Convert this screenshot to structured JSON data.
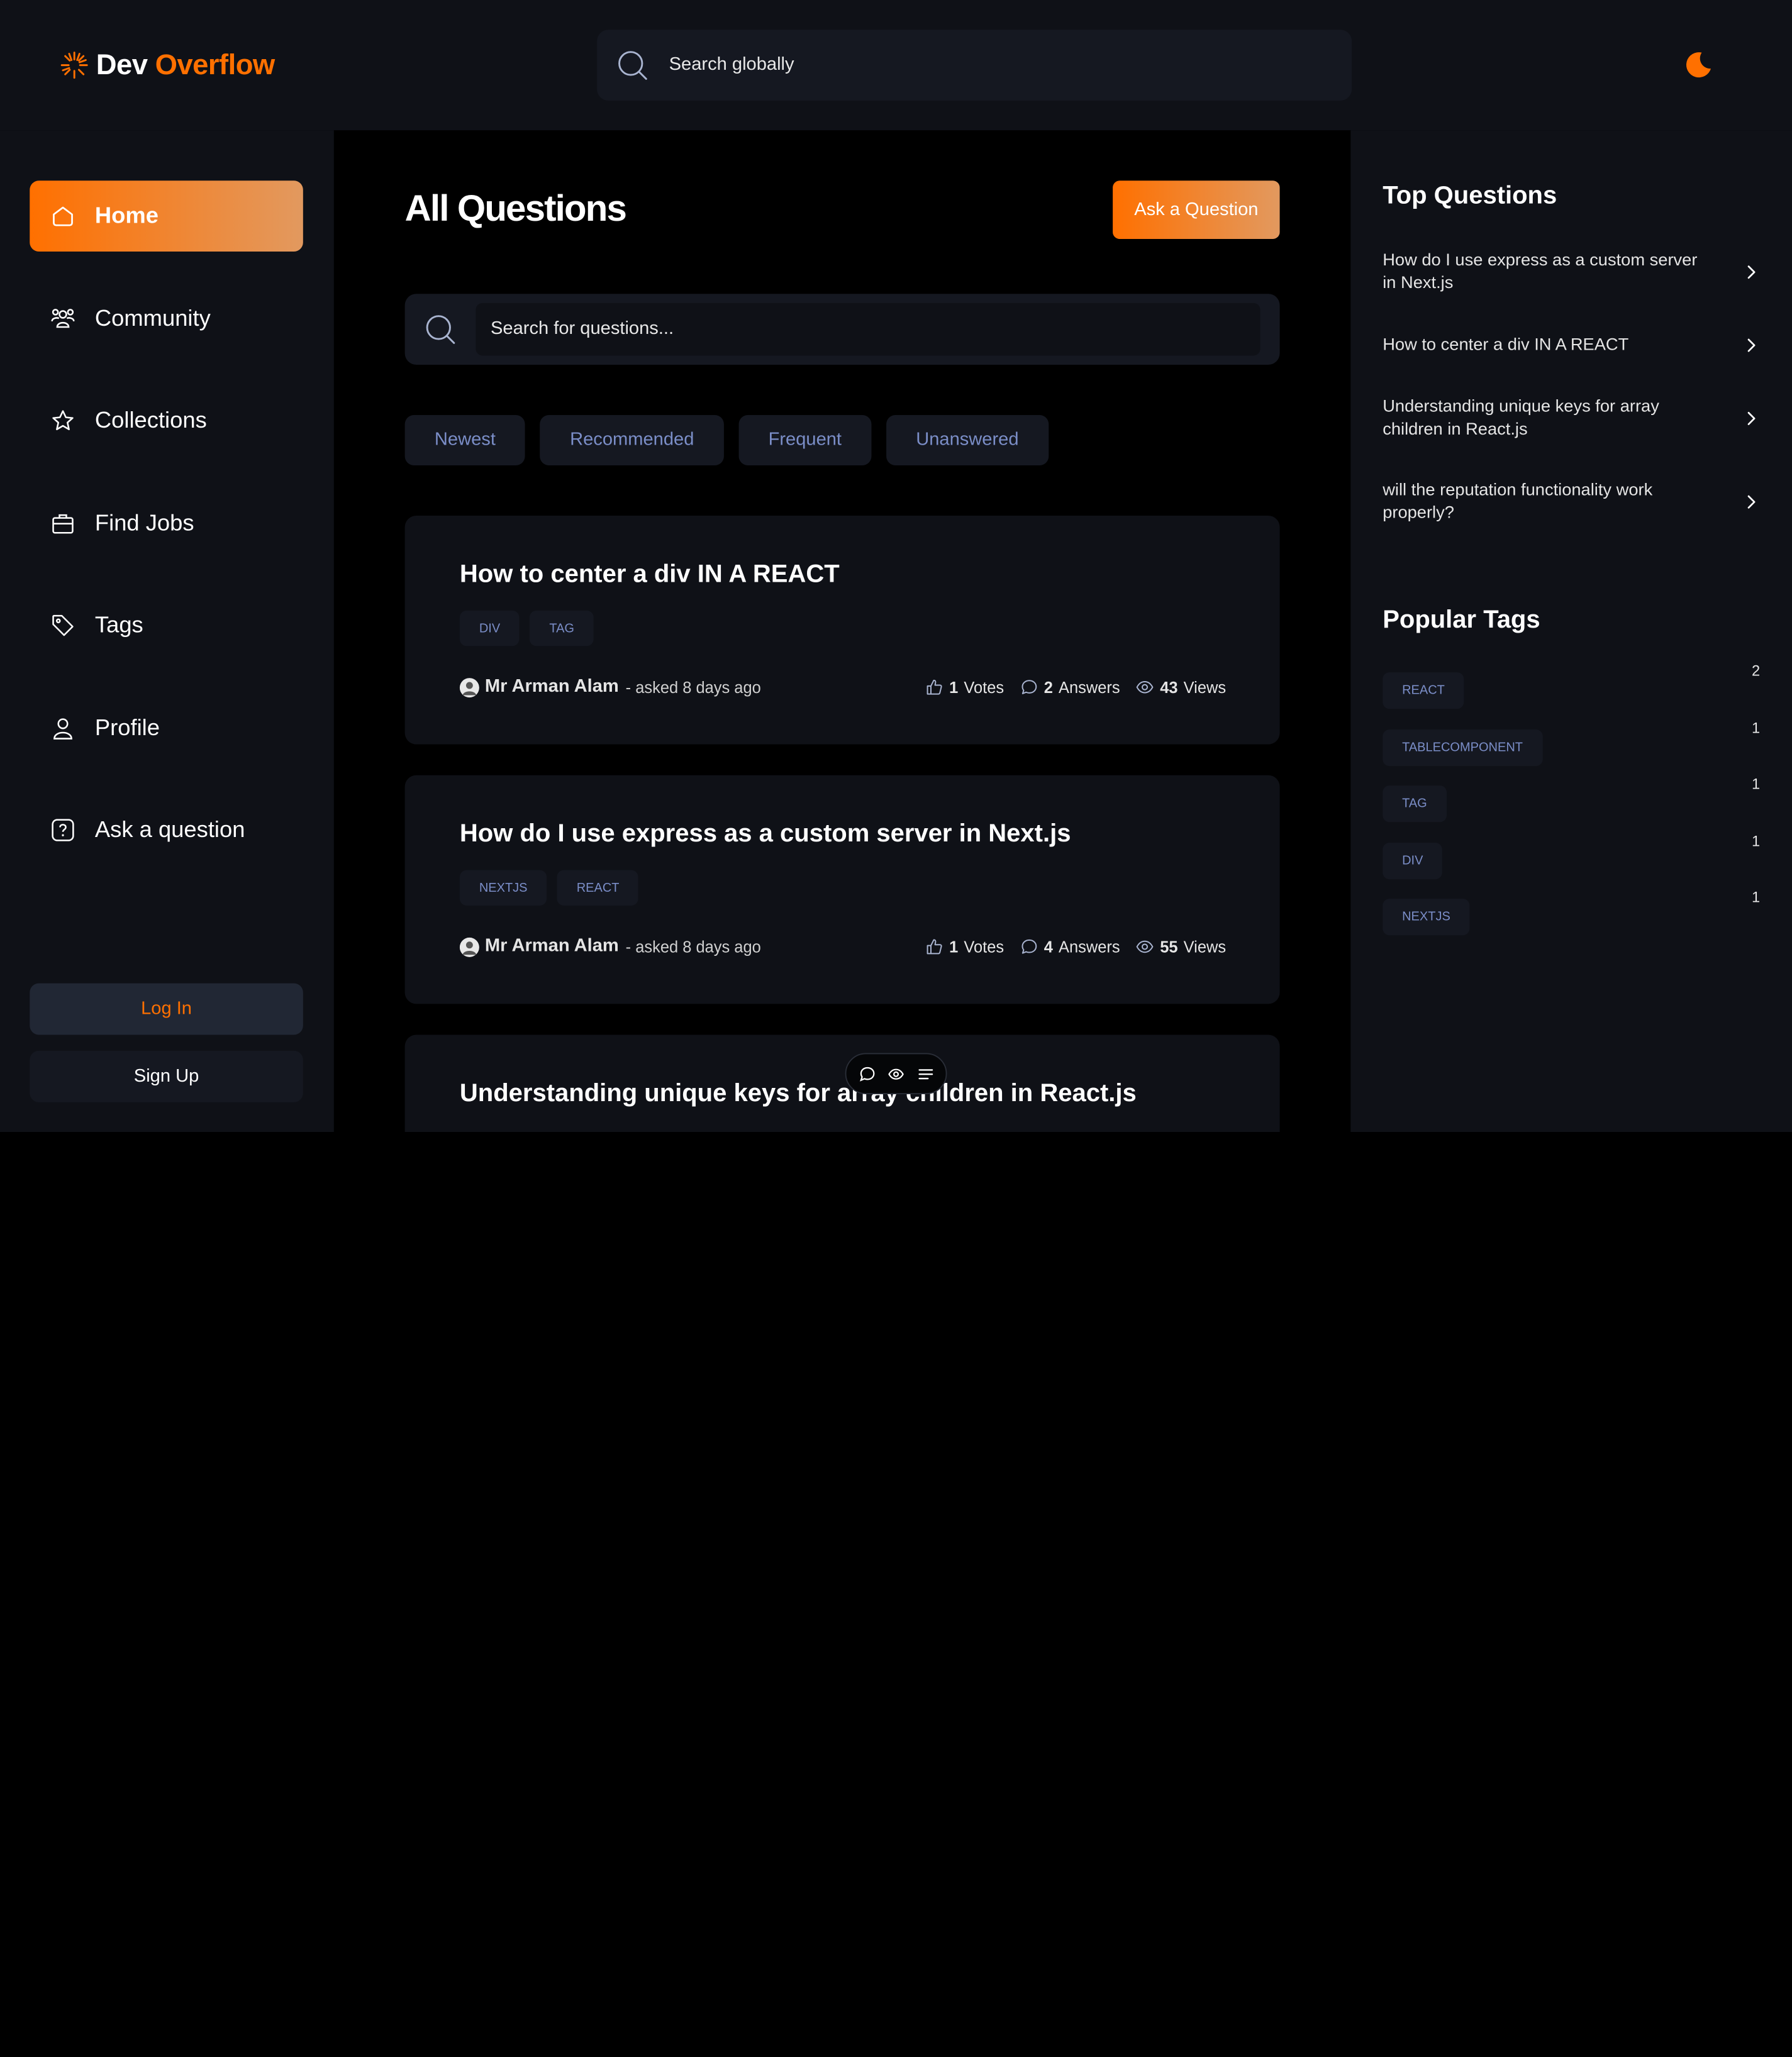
{
  "brand": {
    "part1": "Dev",
    "part2": "Overflow"
  },
  "global_search": {
    "placeholder": "Search globally"
  },
  "nav": [
    {
      "label": "Home",
      "icon": "home-icon",
      "active": true
    },
    {
      "label": "Community",
      "icon": "users-icon"
    },
    {
      "label": "Collections",
      "icon": "star-icon"
    },
    {
      "label": "Find Jobs",
      "icon": "briefcase-icon"
    },
    {
      "label": "Tags",
      "icon": "tag-icon"
    },
    {
      "label": "Profile",
      "icon": "user-icon"
    },
    {
      "label": "Ask a question",
      "icon": "question-icon"
    }
  ],
  "auth": {
    "login": "Log In",
    "signup": "Sign Up"
  },
  "main": {
    "title": "All Questions",
    "ask_button": "Ask a Question",
    "search_placeholder": "Search for questions...",
    "filters": [
      "Newest",
      "Recommended",
      "Frequent",
      "Unanswered"
    ],
    "questions": [
      {
        "title": "How to center a div IN A REACT",
        "tags": [
          "DIV",
          "TAG"
        ],
        "author": "Mr Arman Alam",
        "asked": "- asked 8 days ago",
        "votes": "1",
        "votes_label": "Votes",
        "answers": "2",
        "answers_label": "Answers",
        "views": "43",
        "views_label": "Views"
      },
      {
        "title": "How do I use express as a custom server in Next.js",
        "tags": [
          "NEXTJS",
          "REACT"
        ],
        "author": "Mr Arman Alam",
        "asked": "- asked 8 days ago",
        "votes": "1",
        "votes_label": "Votes",
        "answers": "4",
        "answers_label": "Answers",
        "views": "55",
        "views_label": "Views"
      },
      {
        "title": "Understanding unique keys for array children in React.js"
      }
    ]
  },
  "right": {
    "top_questions_heading": "Top Questions",
    "top_questions": [
      "How do I use express as a custom server in Next.js",
      "How to center a div IN A REACT",
      "Understanding unique keys for array children in React.js",
      "will the reputation functionality work properly?"
    ],
    "popular_tags_heading": "Popular Tags",
    "popular_tags": [
      {
        "name": "REACT",
        "count": "2"
      },
      {
        "name": "TABLECOMPONENT",
        "count": "1"
      },
      {
        "name": "TAG",
        "count": "1"
      },
      {
        "name": "DIV",
        "count": "1"
      },
      {
        "name": "NEXTJS",
        "count": "1"
      }
    ]
  },
  "colors": {
    "accent": "#ff7000",
    "accent_light": "#e2995f",
    "panel": "#0f1117",
    "card": "#151821",
    "tag_text": "#7b8ec8"
  }
}
